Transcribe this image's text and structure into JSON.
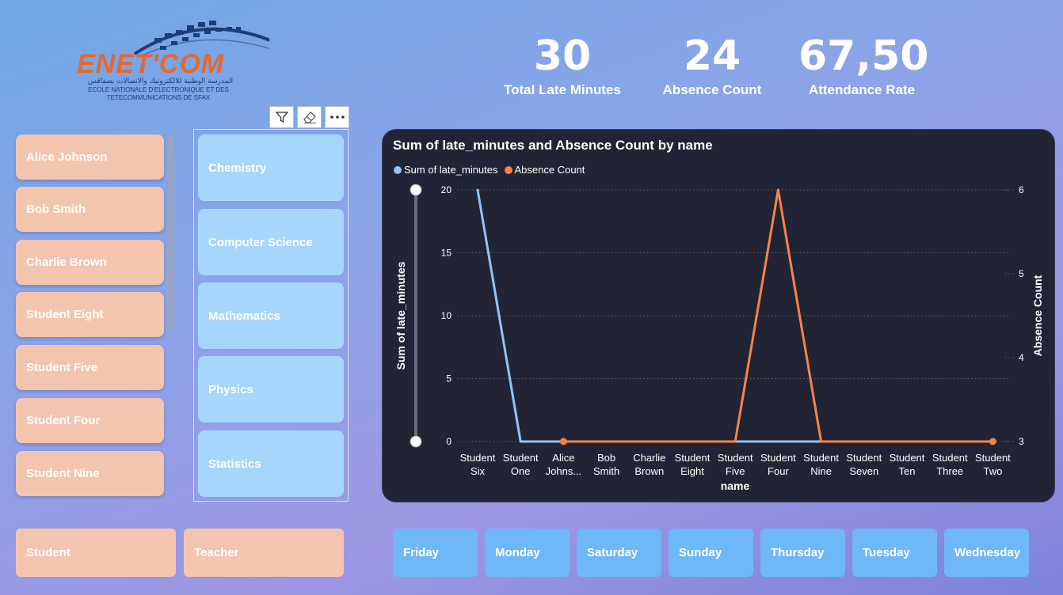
{
  "logo": {
    "brand": "ENET'COM",
    "arabic": "المدرسة الوطنية للالكترونيك والاتصالات بصفاقس",
    "sub_line1": "ECOLE NATIONALE D'ELECTRONIQUE ET DES",
    "sub_line2": "TETECOMMUNICATIONS DE SFAX"
  },
  "kpis": [
    {
      "value": "30",
      "label": "Total Late Minutes"
    },
    {
      "value": "24",
      "label": "Absence Count"
    },
    {
      "value": "67,50",
      "label": "Attendance Rate"
    }
  ],
  "names": [
    "Alice Johnson",
    "Bob Smith",
    "Charlie Brown",
    "Student Eight",
    "Student Five",
    "Student Four",
    "Student Nine"
  ],
  "subjects": [
    "Chemistry",
    "Computer Science",
    "Mathematics",
    "Physics",
    "Statistics"
  ],
  "roles": [
    "Student",
    "Teacher"
  ],
  "days": [
    "Friday",
    "Monday",
    "Saturday",
    "Sunday",
    "Thursday",
    "Tuesday",
    "Wednesday"
  ],
  "icons": {
    "filter": "filter-icon",
    "eraser": "eraser-icon",
    "more": "more-options-icon"
  },
  "colors": {
    "late": "#8fc5f5",
    "absence": "#f2854f",
    "name_tile": "#f4c5ae",
    "subject_tile": "#a6d6fc",
    "day_tile": "#6fb8f7",
    "chart_bg": "#212434"
  },
  "chart_data": {
    "type": "line",
    "title": "Sum of late_minutes and Absence Count by name",
    "xlabel": "name",
    "ylabel": "Sum of late_minutes",
    "y2label": "Absence Count",
    "categories": [
      "Student Six",
      "Student One",
      "Alice Johns...",
      "Bob Smith",
      "Charlie Brown",
      "Student Eight",
      "Student Five",
      "Student Four",
      "Student Nine",
      "Student Seven",
      "Student Ten",
      "Student Three",
      "Student Two"
    ],
    "category_lines": [
      [
        "Student",
        "Six"
      ],
      [
        "Student",
        "One"
      ],
      [
        "Alice",
        "Johns..."
      ],
      [
        "Bob",
        "Smith"
      ],
      [
        "Charlie",
        "Brown"
      ],
      [
        "Student",
        "Eight"
      ],
      [
        "Student",
        "Five"
      ],
      [
        "Student",
        "Four"
      ],
      [
        "Student",
        "Nine"
      ],
      [
        "Student",
        "Seven"
      ],
      [
        "Student",
        "Ten"
      ],
      [
        "Student",
        "Three"
      ],
      [
        "Student",
        "Two"
      ]
    ],
    "series": [
      {
        "name": "Sum of late_minutes",
        "axis": "left",
        "values": [
          20,
          0,
          0,
          0,
          0,
          0,
          0,
          0,
          0,
          0,
          0,
          0,
          0
        ]
      },
      {
        "name": "Absence Count",
        "axis": "right",
        "values": [
          null,
          null,
          3,
          3,
          3,
          3,
          3,
          6,
          3,
          3,
          3,
          3,
          3
        ]
      }
    ],
    "ylim": [
      0,
      20
    ],
    "y_ticks": [
      "0",
      "5",
      "10",
      "15",
      "20"
    ],
    "y2lim": [
      3,
      6
    ],
    "y2_ticks": [
      "3",
      "4",
      "5",
      "6"
    ],
    "grid": true,
    "legend_position": "top-left"
  }
}
